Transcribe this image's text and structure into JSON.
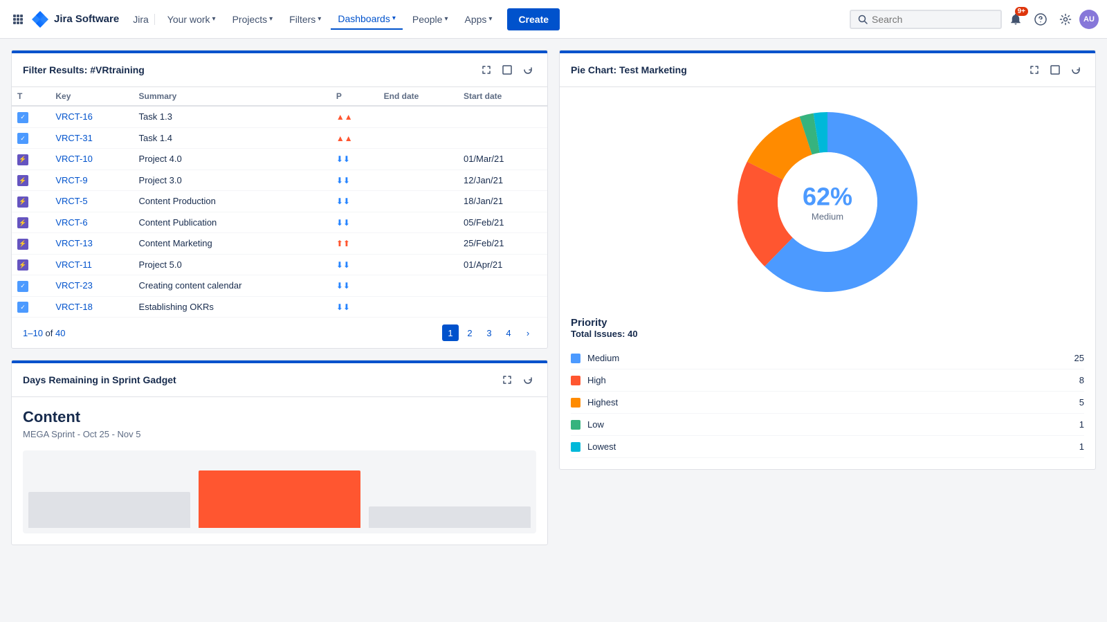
{
  "nav": {
    "logo_text": "Jira Software",
    "jira_label": "Jira",
    "items": [
      {
        "label": "Your work",
        "active": false
      },
      {
        "label": "Projects",
        "active": false
      },
      {
        "label": "Filters",
        "active": false
      },
      {
        "label": "Dashboards",
        "active": true
      },
      {
        "label": "People",
        "active": false
      },
      {
        "label": "Apps",
        "active": false
      }
    ],
    "create_label": "Create",
    "search_placeholder": "Search",
    "notification_count": "9+",
    "avatar_initials": "AU"
  },
  "filter_panel": {
    "title": "Filter Results: #VRtraining",
    "columns": [
      "T",
      "Key",
      "Summary",
      "P",
      "End date",
      "Start date"
    ],
    "rows": [
      {
        "type": "task",
        "key": "VRCT-16",
        "summary": "Task 1.3",
        "priority": "high",
        "end_date": "",
        "start_date": ""
      },
      {
        "type": "task",
        "key": "VRCT-31",
        "summary": "Task 1.4",
        "priority": "high",
        "end_date": "",
        "start_date": ""
      },
      {
        "type": "epic",
        "key": "VRCT-10",
        "summary": "Project 4.0",
        "priority": "lowest",
        "end_date": "",
        "start_date": "01/Mar/21"
      },
      {
        "type": "epic",
        "key": "VRCT-9",
        "summary": "Project 3.0",
        "priority": "lowest",
        "end_date": "",
        "start_date": "12/Jan/21"
      },
      {
        "type": "epic",
        "key": "VRCT-5",
        "summary": "Content Production",
        "priority": "lowest",
        "end_date": "",
        "start_date": "18/Jan/21"
      },
      {
        "type": "epic",
        "key": "VRCT-6",
        "summary": "Content Publication",
        "priority": "lowest",
        "end_date": "",
        "start_date": "05/Feb/21"
      },
      {
        "type": "epic",
        "key": "VRCT-13",
        "summary": "Content Marketing",
        "priority": "highest",
        "end_date": "",
        "start_date": "25/Feb/21"
      },
      {
        "type": "epic",
        "key": "VRCT-11",
        "summary": "Project 5.0",
        "priority": "lowest",
        "end_date": "",
        "start_date": "01/Apr/21"
      },
      {
        "type": "task",
        "key": "VRCT-23",
        "summary": "Creating content calendar",
        "priority": "lowest",
        "end_date": "",
        "start_date": ""
      },
      {
        "type": "task",
        "key": "VRCT-18",
        "summary": "Establishing OKRs",
        "priority": "lowest",
        "end_date": "",
        "start_date": ""
      }
    ],
    "pagination": {
      "range": "1–10",
      "total": "40",
      "current_page": 1,
      "pages": [
        "1",
        "2",
        "3",
        "4"
      ]
    }
  },
  "pie_panel": {
    "title": "Pie Chart: Test Marketing",
    "center_percent": "62%",
    "center_label": "Medium",
    "priority_header": "Priority",
    "total_label": "Total Issues:",
    "total_value": "40",
    "legend": [
      {
        "name": "Medium",
        "color": "#4c9aff",
        "count": 25
      },
      {
        "name": "High",
        "color": "#ff5630",
        "count": 8
      },
      {
        "name": "Highest",
        "color": "#ff8b00",
        "count": 5
      },
      {
        "name": "Low",
        "color": "#36b37e",
        "count": 1
      },
      {
        "name": "Lowest",
        "color": "#00b8d9",
        "count": 1
      }
    ],
    "chart": {
      "segments": [
        {
          "label": "Medium",
          "color": "#4c9aff",
          "percent": 62,
          "start": 0,
          "sweep": 223.2
        },
        {
          "label": "High",
          "color": "#ff5630",
          "percent": 20,
          "start": 223.2,
          "sweep": 72
        },
        {
          "label": "Highest",
          "color": "#ff8b00",
          "percent": 12.5,
          "start": 295.2,
          "sweep": 45
        },
        {
          "label": "Low",
          "color": "#36b37e",
          "percent": 2.5,
          "start": 340.2,
          "sweep": 9
        },
        {
          "label": "Lowest",
          "color": "#00b8d9",
          "percent": 2.5,
          "start": 349.2,
          "sweep": 9
        }
      ]
    }
  },
  "sprint_panel": {
    "title": "Days Remaining in Sprint Gadget",
    "sprint_name": "Content",
    "sprint_dates": "MEGA Sprint - Oct 25 - Nov 5"
  }
}
